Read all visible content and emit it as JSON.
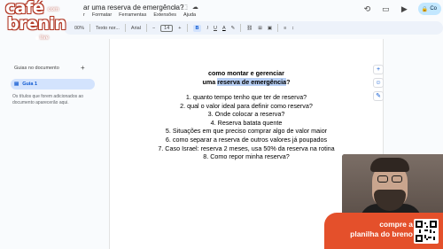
{
  "header": {
    "doc_title": "ar uma reserva de emergência?",
    "menus": [
      "r",
      "Formatar",
      "Ferramentas",
      "Extensões",
      "Ajuda"
    ],
    "share_label": "Co"
  },
  "toolbar": {
    "zoom": "00%",
    "style": "Texto nor...",
    "font": "Arial",
    "font_size": "14",
    "bold": "B",
    "italic": "I",
    "underline": "U",
    "text_color": "A"
  },
  "sidebar": {
    "title": "Guias no documento",
    "add": "+",
    "tab_label": "Guia 1",
    "note": "Os títulos que forem adicionados ao documento aparecerão aqui."
  },
  "document": {
    "heading_line1": "como montar e gerenciar",
    "heading_line2_prefix": "uma ",
    "heading_line2_highlight": "reserva de emergência",
    "heading_line2_suffix": "?",
    "items": [
      "1.  quanto tempo tenho que ter de reserva?",
      "2.  qual o valor ideal para definir como reserva?",
      "3.  Onde colocar a reserva?",
      "4.  Reserva batata quente",
      "5.  Situações em que preciso comprar algo de valor maior",
      "6.  como separar a reserva de outros valores já poupados",
      "7.  Caso Israel: reserva 2 meses, usa 50% da reserva na rotina",
      "8.  Como repor minha reserva?"
    ]
  },
  "logo": {
    "line1": "café",
    "com": "com",
    "line2": "brenin",
    "live": "live"
  },
  "promo": {
    "line1": "compre a",
    "line2": "planilha do breno"
  },
  "colors": {
    "accent_blue": "#0b57d0",
    "highlight": "#b8d0f5",
    "promo_orange": "#e4502b",
    "share_bg": "#c2e7ff"
  }
}
